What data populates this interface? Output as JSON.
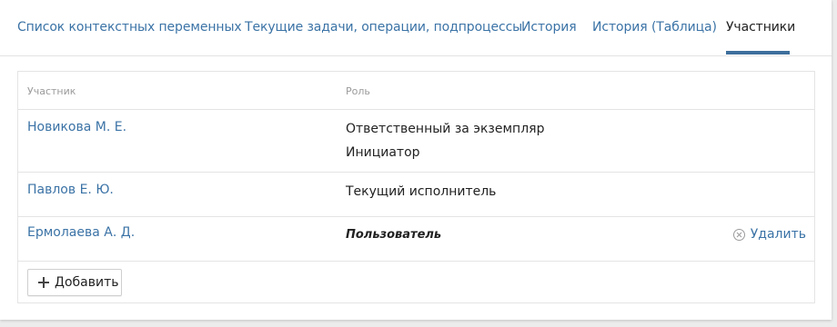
{
  "tabs": [
    {
      "label": "Список контекстных переменных"
    },
    {
      "label": "Текущие задачи, операции, подпроцессы"
    },
    {
      "label": "История"
    },
    {
      "label": "История (Таблица)"
    },
    {
      "label": "Участники"
    }
  ],
  "active_tab": "Участники",
  "table": {
    "headers": {
      "participant": "Участник",
      "role": "Роль"
    },
    "rows": [
      {
        "name": "Новикова М. Е.",
        "roles": [
          "Ответственный за экземпляр",
          "Инициатор"
        ]
      },
      {
        "name": "Павлов Е. Ю.",
        "roles": [
          "Текущий исполнитель"
        ]
      },
      {
        "name": "Ермолаева А. Д.",
        "roles": [
          "Пользователь"
        ],
        "action": "Удалить"
      }
    ]
  },
  "add_button": {
    "label": "Добавить",
    "icon": "plus-icon"
  },
  "colors": {
    "link": "#3b73a6",
    "tab_underline": "#3e6f9c",
    "text": "#222222",
    "muted": "#9a9a9a"
  }
}
